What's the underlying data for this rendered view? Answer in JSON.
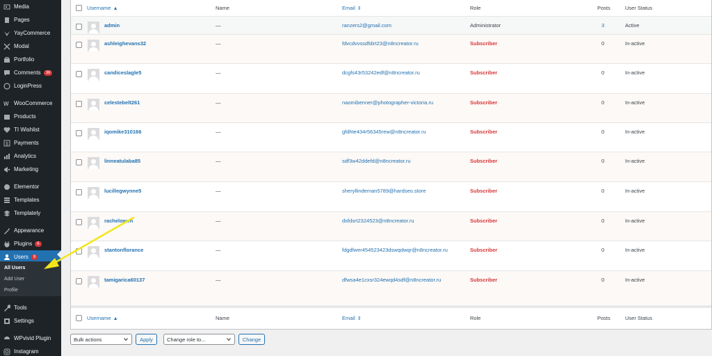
{
  "sidebar": {
    "items": [
      {
        "label": "Media",
        "icon": "media-icon",
        "top": 0
      },
      {
        "label": "Pages",
        "icon": "pages-icon"
      },
      {
        "label": "YayCommerce",
        "icon": "yaycommerce-icon"
      },
      {
        "label": "Modal",
        "icon": "modal-icon"
      },
      {
        "label": "Portfolio",
        "icon": "portfolio-icon"
      },
      {
        "label": "Comments",
        "icon": "comments-icon",
        "badge": "38"
      },
      {
        "label": "LoginPress",
        "icon": "loginpress-icon"
      },
      {
        "label": "WooCommerce",
        "icon": "woocommerce-icon"
      },
      {
        "label": "Products",
        "icon": "products-icon"
      },
      {
        "label": "TI Wishlist",
        "icon": "wishlist-icon"
      },
      {
        "label": "Payments",
        "icon": "payments-icon"
      },
      {
        "label": "Analytics",
        "icon": "analytics-icon"
      },
      {
        "label": "Marketing",
        "icon": "marketing-icon"
      },
      {
        "label": "Elementor",
        "icon": "elementor-icon"
      },
      {
        "label": "Templates",
        "icon": "templates-icon"
      },
      {
        "label": "Templately",
        "icon": "templately-icon"
      },
      {
        "label": "Appearance",
        "icon": "appearance-icon"
      },
      {
        "label": "Plugins",
        "icon": "plugins-icon",
        "badge": "6"
      },
      {
        "label": "Users",
        "icon": "users-icon",
        "badge": "9",
        "active": true
      },
      {
        "label": "Tools",
        "icon": "tools-icon"
      },
      {
        "label": "Settings",
        "icon": "settings-icon"
      },
      {
        "label": "WPvivid Plugin",
        "icon": "wpvivid-icon"
      },
      {
        "label": "Instagram",
        "icon": "instagram-icon"
      }
    ],
    "submenu": [
      "All Users",
      "Add User",
      "Profile"
    ],
    "active_color": "#2271b1"
  },
  "table": {
    "columns": {
      "username": "Username",
      "name": "Name",
      "email": "Email",
      "role": "Role",
      "posts": "Posts",
      "status": "User Status"
    },
    "sort_icon_username": "▲",
    "sort_icon_email": "⇕",
    "rows": [
      {
        "username": "admin",
        "name": "—",
        "email": "ranzers2@gmail.com",
        "role": "Administrator",
        "posts": "3",
        "status": "Active"
      },
      {
        "username": "ashleighevans32",
        "name": "—",
        "email": "fdvcdvvssdfdirt23@n8ncreator.ru",
        "role": "Subscriber",
        "posts": "0",
        "status": "In-active"
      },
      {
        "username": "candiceslagle5",
        "name": "—",
        "email": "dcgfs43r53242edf@n8ncreator.ru",
        "role": "Subscriber",
        "posts": "0",
        "status": "In-active"
      },
      {
        "username": "celestebelt261",
        "name": "—",
        "email": "naomibenner@photographer-victoria.ru",
        "role": "Subscriber",
        "posts": "0",
        "status": "In-active"
      },
      {
        "username": "iqomike310166",
        "name": "—",
        "email": "gfdhte434r56345rew@n8ncreator.ru",
        "role": "Subscriber",
        "posts": "0",
        "status": "In-active"
      },
      {
        "username": "linneatulaba85",
        "name": "—",
        "email": "sdf3w42ddefd@n8ncreator.ru",
        "role": "Subscriber",
        "posts": "0",
        "status": "In-active"
      },
      {
        "username": "lucillegwynne5",
        "name": "—",
        "email": "sheryllindeman5789@hardseo.store",
        "role": "Subscriber",
        "posts": "0",
        "status": "In-active"
      },
      {
        "username": "rachelowen",
        "name": "—",
        "email": "dsfdsrt2324523@n8ncreator.ru",
        "role": "Subscriber",
        "posts": "0",
        "status": "In-active"
      },
      {
        "username": "stantonflorance",
        "name": "—",
        "email": "fdgdfwer454523423dswqdwqr@n8ncreator.ru",
        "role": "Subscriber",
        "posts": "0",
        "status": "In-active"
      },
      {
        "username": "tamigarica60137",
        "name": "—",
        "email": "dfwsa4e1cxsr324ewqd4sdf@n8ncreator.ru",
        "role": "Subscriber",
        "posts": "0",
        "status": "In-active"
      }
    ]
  },
  "actions": {
    "bulk_select": "Bulk actions",
    "apply": "Apply",
    "role_select": "Change role to...",
    "change": "Change"
  },
  "colors": {
    "subscriber": "#d63638",
    "link": "#2271b1",
    "annotation": "#f2e61a"
  }
}
